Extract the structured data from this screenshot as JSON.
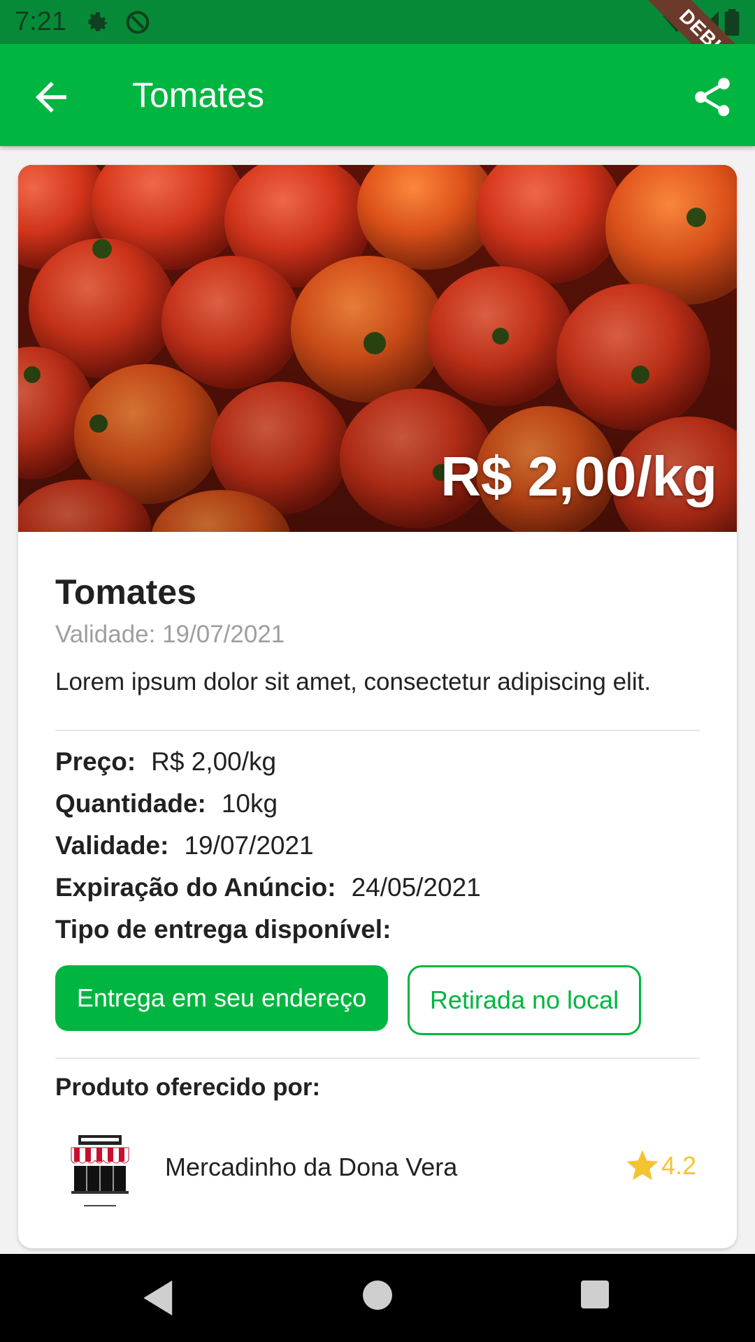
{
  "status_bar": {
    "time": "7:21",
    "debug_label": "DEBUG"
  },
  "app_bar": {
    "title": "Tomates"
  },
  "product": {
    "hero_price": "R$ 2,00/kg",
    "title": "Tomates",
    "validity_line": "Validade: 19/07/2021",
    "description": "Lorem ipsum dolor sit amet, consectetur adipiscing elit."
  },
  "details": {
    "price_label": "Preço:",
    "price_value": "R$ 2,00/kg",
    "quantity_label": "Quantidade:",
    "quantity_value": "10kg",
    "validity_label": "Validade:",
    "validity_value": "19/07/2021",
    "expiration_label": "Expiração do Anúncio:",
    "expiration_value": "24/05/2021",
    "delivery_type_label": "Tipo de entrega disponível:"
  },
  "delivery_options": {
    "delivery": "Entrega em seu endereço",
    "pickup": "Retirada no local"
  },
  "seller": {
    "section_label": "Produto oferecido por:",
    "name": "Mercadinho da Dona Vera",
    "rating": "4.2"
  },
  "colors": {
    "primary": "#00b640",
    "status_bar": "#078a37",
    "rating_star": "#f4c430"
  },
  "icons": [
    "settings-icon",
    "at-sign-icon",
    "wifi-icon",
    "signal-icon",
    "battery-icon",
    "back-arrow-icon",
    "share-icon",
    "star-icon",
    "nav-back-icon",
    "nav-home-icon",
    "nav-recents-icon"
  ]
}
